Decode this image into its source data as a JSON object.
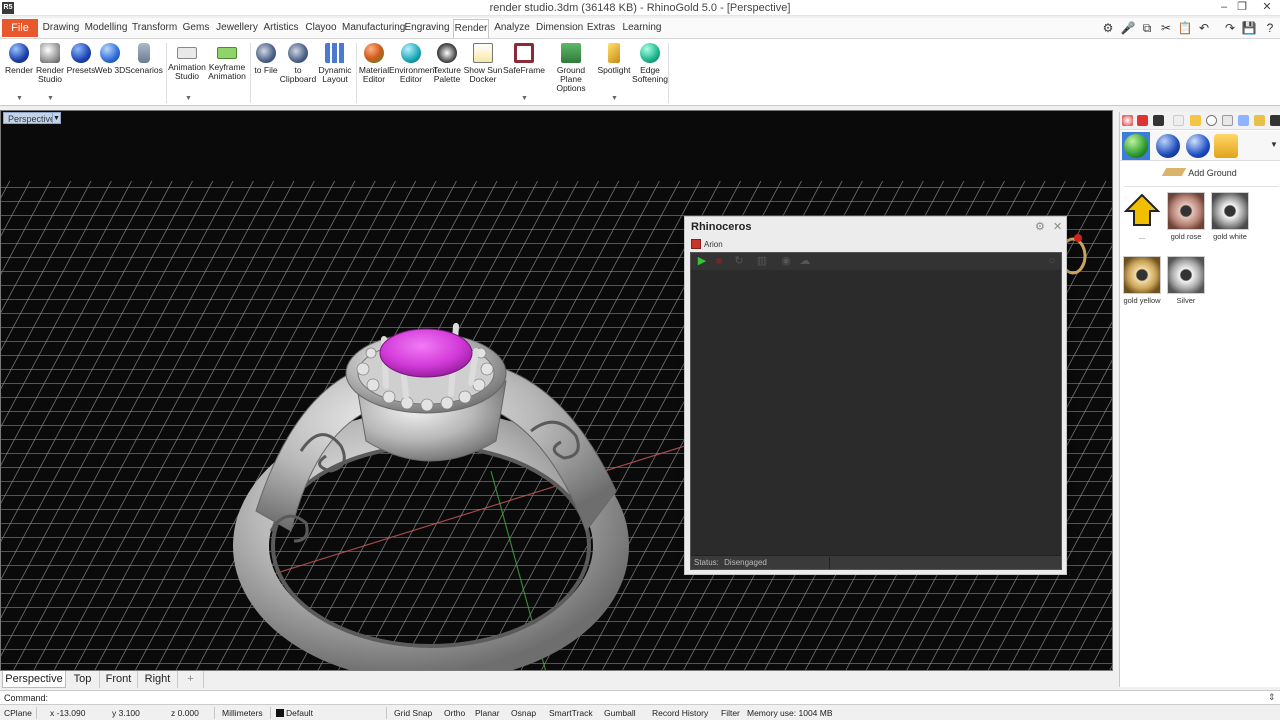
{
  "window": {
    "title": "render studio.3dm (36148 KB) - RhinoGold 5.0 - [Perspective]",
    "app_icon": "R5"
  },
  "ribbon_tabs": [
    "File",
    "Drawing",
    "Modelling",
    "Transform",
    "Gems",
    "Jewellery",
    "Artistics",
    "Clayoo",
    "Manufacturing",
    "Engraving",
    "Render",
    "Analyze",
    "Dimension",
    "Extras",
    "Learning"
  ],
  "active_tab": "Render",
  "ribbon_buttons": [
    {
      "label": "Render"
    },
    {
      "label": "Render Studio"
    },
    {
      "label": "Presets"
    },
    {
      "label": "Web 3D"
    },
    {
      "label": "Scenarios"
    },
    {
      "label": "Animation Studio"
    },
    {
      "label": "Keyframe Animation"
    },
    {
      "label": "to File"
    },
    {
      "label": "to Clipboard"
    },
    {
      "label": "Dynamic Layout"
    },
    {
      "label": "Material Editor"
    },
    {
      "label": "Environment Editor"
    },
    {
      "label": "Texture Palette"
    },
    {
      "label": "Show Sun Docker"
    },
    {
      "label": "SafeFrame"
    },
    {
      "label": "Ground Plane Options"
    },
    {
      "label": "Spotlight"
    },
    {
      "label": "Edge Softening"
    }
  ],
  "viewport": {
    "label": "Perspective",
    "model_description": "ring"
  },
  "rhino_panel": {
    "title": "Rhinoceros",
    "tab": "Arion",
    "status_label": "Status:",
    "status_value": "Disengaged"
  },
  "view_tabs": [
    "Perspective",
    "Top",
    "Front",
    "Right"
  ],
  "view_tab_add": "+",
  "right_panel": {
    "add_ground": "Add Ground",
    "materials": [
      {
        "name": "...",
        "color": "#e8b800"
      },
      {
        "name": "gold rose",
        "color": "#b88478"
      },
      {
        "name": "gold white",
        "color": "#9a9a9a"
      },
      {
        "name": "gold yellow",
        "color": "#c9a257"
      },
      {
        "name": "Silver",
        "color": "#a8a8a8"
      }
    ]
  },
  "command": {
    "label": "Command:"
  },
  "status_bar": {
    "cplane": "CPlane",
    "x": "x -13.090",
    "y": "y 3.100",
    "z": "z 0.000",
    "units": "Millimeters",
    "layer": "Default",
    "grid_snap": "Grid Snap",
    "ortho": "Ortho",
    "planar": "Planar",
    "osnap": "Osnap",
    "smarttrack": "SmartTrack",
    "gumball": "Gumball",
    "record_history": "Record History",
    "filter": "Filter",
    "memory": "Memory use: 1004 MB"
  },
  "colors": {
    "file_tab": "#e9572c",
    "accent": "#3d7cd9",
    "gem": "#d23ad9",
    "viewport_bg": "#0a0a0a"
  }
}
